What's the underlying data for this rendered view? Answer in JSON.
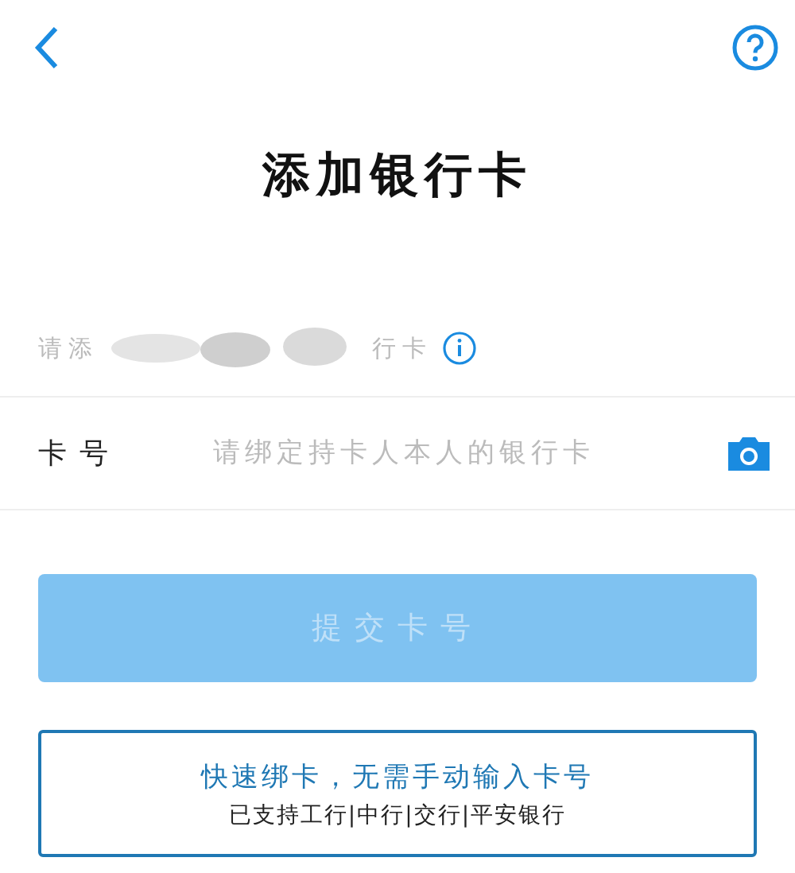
{
  "header": {
    "title": "添加银行卡"
  },
  "notice": {
    "prefix": "请添",
    "suffix": "行卡"
  },
  "card_field": {
    "label": "卡号",
    "placeholder": "请绑定持卡人本人的银行卡"
  },
  "submit": {
    "label": "提交卡号",
    "disabled": true
  },
  "quick_bind": {
    "title": "快速绑卡，无需手动输入卡号",
    "subtitle": "已支持工行|中行|交行|平安银行"
  }
}
